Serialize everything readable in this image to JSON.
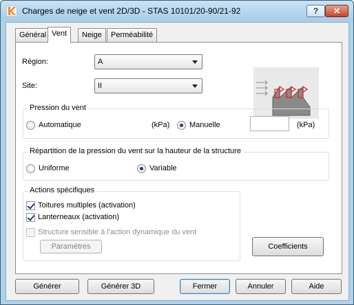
{
  "window": {
    "title": "Charges de neige et vent 2D/3D - STAS 10101/20-90/21-92",
    "help_label": "?",
    "close_label": "✕"
  },
  "tabs": [
    {
      "label": "Général",
      "active": false
    },
    {
      "label": "Vent",
      "active": true
    },
    {
      "label": "Neige",
      "active": false
    },
    {
      "label": "Perméabilité",
      "active": false
    }
  ],
  "fields": {
    "region_label": "Région:",
    "region_value": "A",
    "site_label": "Site:",
    "site_value": "II"
  },
  "pressure": {
    "group_title": "Pression du vent",
    "auto_label": "Automatique",
    "unit_left": "(kPa)",
    "manual_label": "Manuelle",
    "manual_value": "",
    "unit_right": "(kPa)",
    "selected": "Manuelle"
  },
  "distribution": {
    "group_title": "Répartition de la pression du vent sur la hauteur de la structure",
    "uniform_label": "Uniforme",
    "variable_label": "Variable",
    "selected": "Variable"
  },
  "actions": {
    "group_title": "Actions spécifiques",
    "multiple_roofs_label": "Toitures multiples (activation)",
    "multiple_roofs_checked": true,
    "skylights_label": "Lanterneaux (activation)",
    "skylights_checked": true,
    "dynamic_label": "Structure sensible à l'action dynamique du vent",
    "dynamic_checked": false,
    "parameters_label": "Paramètres"
  },
  "coefficients_label": "Coefficients",
  "footer": {
    "generate_label": "Générer",
    "generate3d_label": "Générer 3D",
    "close_label": "Fermer",
    "cancel_label": "Annuler",
    "help_label": "Aide"
  },
  "colors": {
    "diagram_highlight": "#e8151b",
    "diagram_fill": "#8a8a8a"
  }
}
